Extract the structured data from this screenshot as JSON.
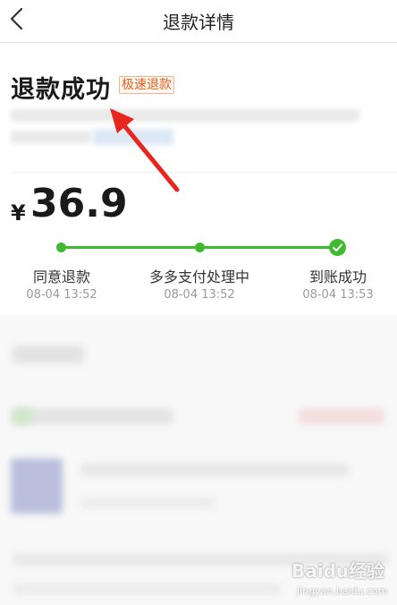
{
  "header": {
    "title": "退款详情",
    "back_icon": "chevron-left-icon"
  },
  "status": {
    "title": "退款成功",
    "badge": "极速退款"
  },
  "amount": {
    "currency": "¥",
    "value": "36.9"
  },
  "progress": {
    "steps": [
      {
        "label": "同意退款",
        "time": "08-04 13:52"
      },
      {
        "label": "多多支付处理中",
        "time": "08-04 13:52"
      },
      {
        "label": "到账成功",
        "time": "08-04 13:53"
      }
    ],
    "completed_steps": 3,
    "accent_color": "#3dbb2c"
  },
  "annotation": {
    "arrow_color": "#e8261d"
  },
  "watermark": {
    "brand": "Baidu经验",
    "sub": "jingyan.baidu.com"
  }
}
